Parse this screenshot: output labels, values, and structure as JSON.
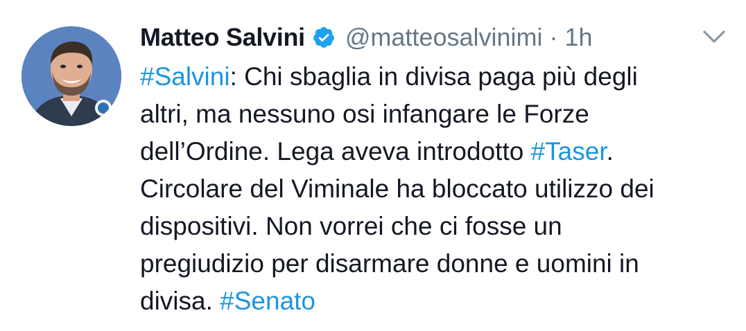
{
  "tweet": {
    "author": {
      "name": "Matteo Salvini",
      "handle": "@matteosalvinimi",
      "verified": true,
      "avatar_icon": "profile-photo"
    },
    "separator": "·",
    "time": "1h",
    "menu_icon": "chevron-down-icon",
    "lines": [
      [
        {
          "type": "hashtag",
          "text": "#Salvini"
        },
        {
          "type": "text",
          "text": ": Chi sbaglia in divisa paga più degli"
        }
      ],
      [
        {
          "type": "text",
          "text": "altri, ma nessuno osi infangare le Forze"
        }
      ],
      [
        {
          "type": "text",
          "text": "dell’Ordine. Lega aveva introdotto "
        },
        {
          "type": "hashtag",
          "text": "#Taser"
        },
        {
          "type": "text",
          "text": "."
        }
      ],
      [
        {
          "type": "text",
          "text": "Circolare del Viminale ha bloccato utilizzo dei"
        }
      ],
      [
        {
          "type": "text",
          "text": "dispositivi. Non vorrei che ci fosse un"
        }
      ],
      [
        {
          "type": "text",
          "text": "pregiudizio per disarmare donne e uomini in"
        }
      ],
      [
        {
          "type": "text",
          "text": "divisa. "
        },
        {
          "type": "hashtag",
          "text": "#Senato"
        }
      ]
    ]
  },
  "colors": {
    "text": "#141823",
    "secondary": "#657786",
    "link": "#1b95e0",
    "verified": "#1da1f2"
  }
}
